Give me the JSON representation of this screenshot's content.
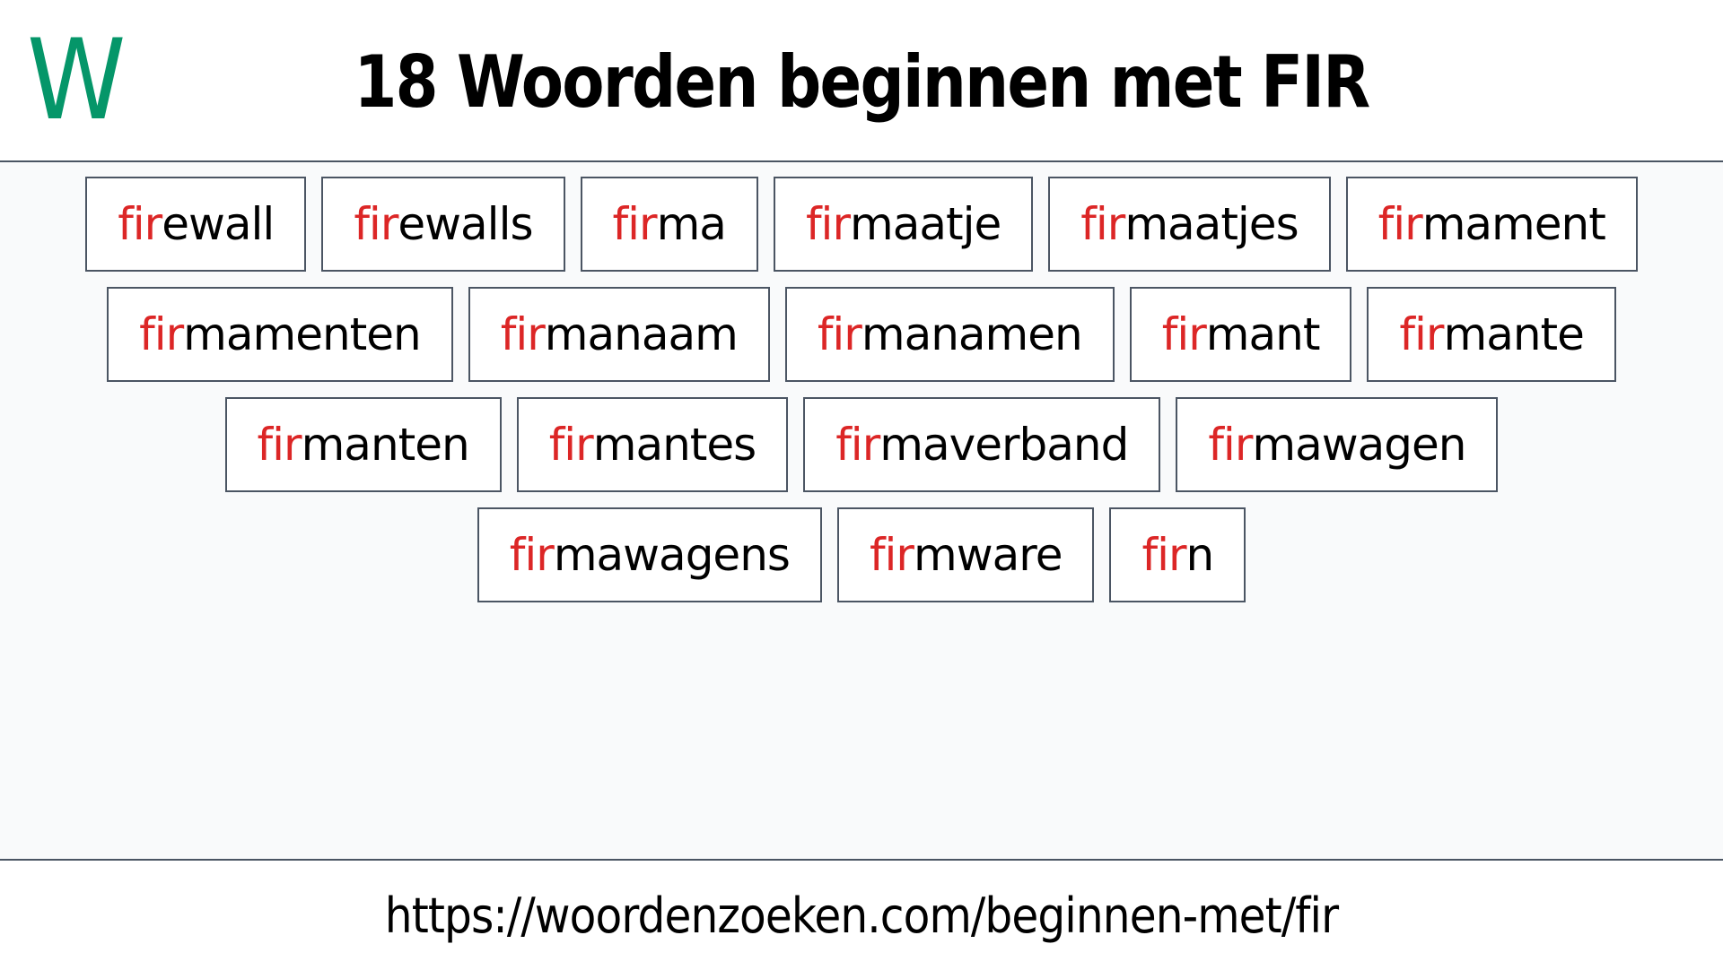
{
  "header": {
    "logo_letter": "W",
    "title": "18 Woorden beginnen met FIR"
  },
  "prefix": "fir",
  "colors": {
    "logo": "#059669",
    "prefix_highlight": "#dc2626",
    "border": "#4b5563",
    "background": "#f9fafb"
  },
  "words": [
    {
      "prefix": "fir",
      "rest": "ewall"
    },
    {
      "prefix": "fir",
      "rest": "ewalls"
    },
    {
      "prefix": "fir",
      "rest": "ma"
    },
    {
      "prefix": "fir",
      "rest": "maatje"
    },
    {
      "prefix": "fir",
      "rest": "maatjes"
    },
    {
      "prefix": "fir",
      "rest": "mament"
    },
    {
      "prefix": "fir",
      "rest": "mamenten"
    },
    {
      "prefix": "fir",
      "rest": "manaam"
    },
    {
      "prefix": "fir",
      "rest": "manamen"
    },
    {
      "prefix": "fir",
      "rest": "mant"
    },
    {
      "prefix": "fir",
      "rest": "mante"
    },
    {
      "prefix": "fir",
      "rest": "manten"
    },
    {
      "prefix": "fir",
      "rest": "mantes"
    },
    {
      "prefix": "fir",
      "rest": "maverband"
    },
    {
      "prefix": "fir",
      "rest": "mawagen"
    },
    {
      "prefix": "fir",
      "rest": "mawagens"
    },
    {
      "prefix": "fir",
      "rest": "mware"
    },
    {
      "prefix": "fir",
      "rest": "n"
    }
  ],
  "footer": {
    "url": "https://woordenzoeken.com/beginnen-met/fir"
  }
}
